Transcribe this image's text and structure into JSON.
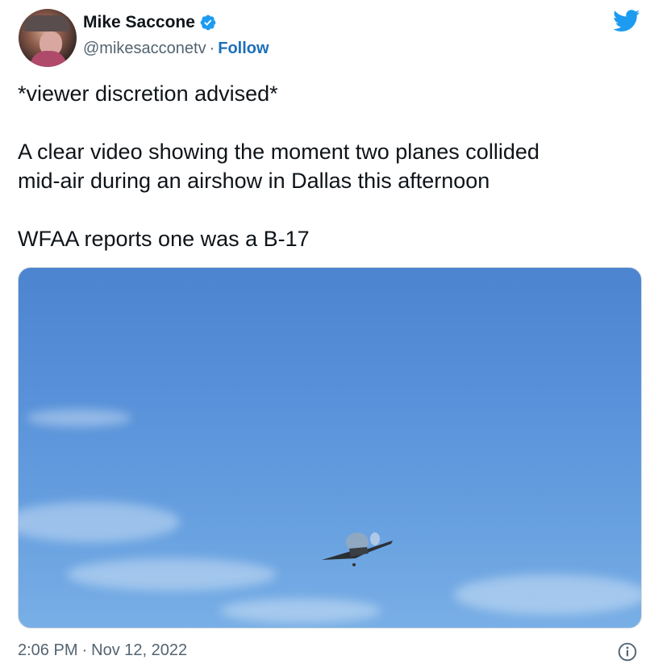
{
  "author": {
    "display_name": "Mike Saccone",
    "handle": "@mikesacconetv",
    "separator": "·",
    "follow_label": "Follow",
    "verified_icon": "verified-badge-icon"
  },
  "brand": {
    "logo_icon": "twitter-bird-icon",
    "accent_color": "#1d9bf0",
    "link_color": "#1d6fb8"
  },
  "tweet": {
    "lines": [
      "*viewer discretion advised*",
      "",
      "A clear video showing the moment two planes collided",
      "mid-air during an airshow in Dallas this afternoon",
      "",
      "WFAA reports one was a B-17"
    ]
  },
  "media": {
    "type": "video-thumbnail",
    "subject": "two-planes-collision-in-blue-sky"
  },
  "footer": {
    "time": "2:06 PM",
    "separator": "·",
    "date": "Nov 12, 2022",
    "info_icon": "info-icon"
  }
}
